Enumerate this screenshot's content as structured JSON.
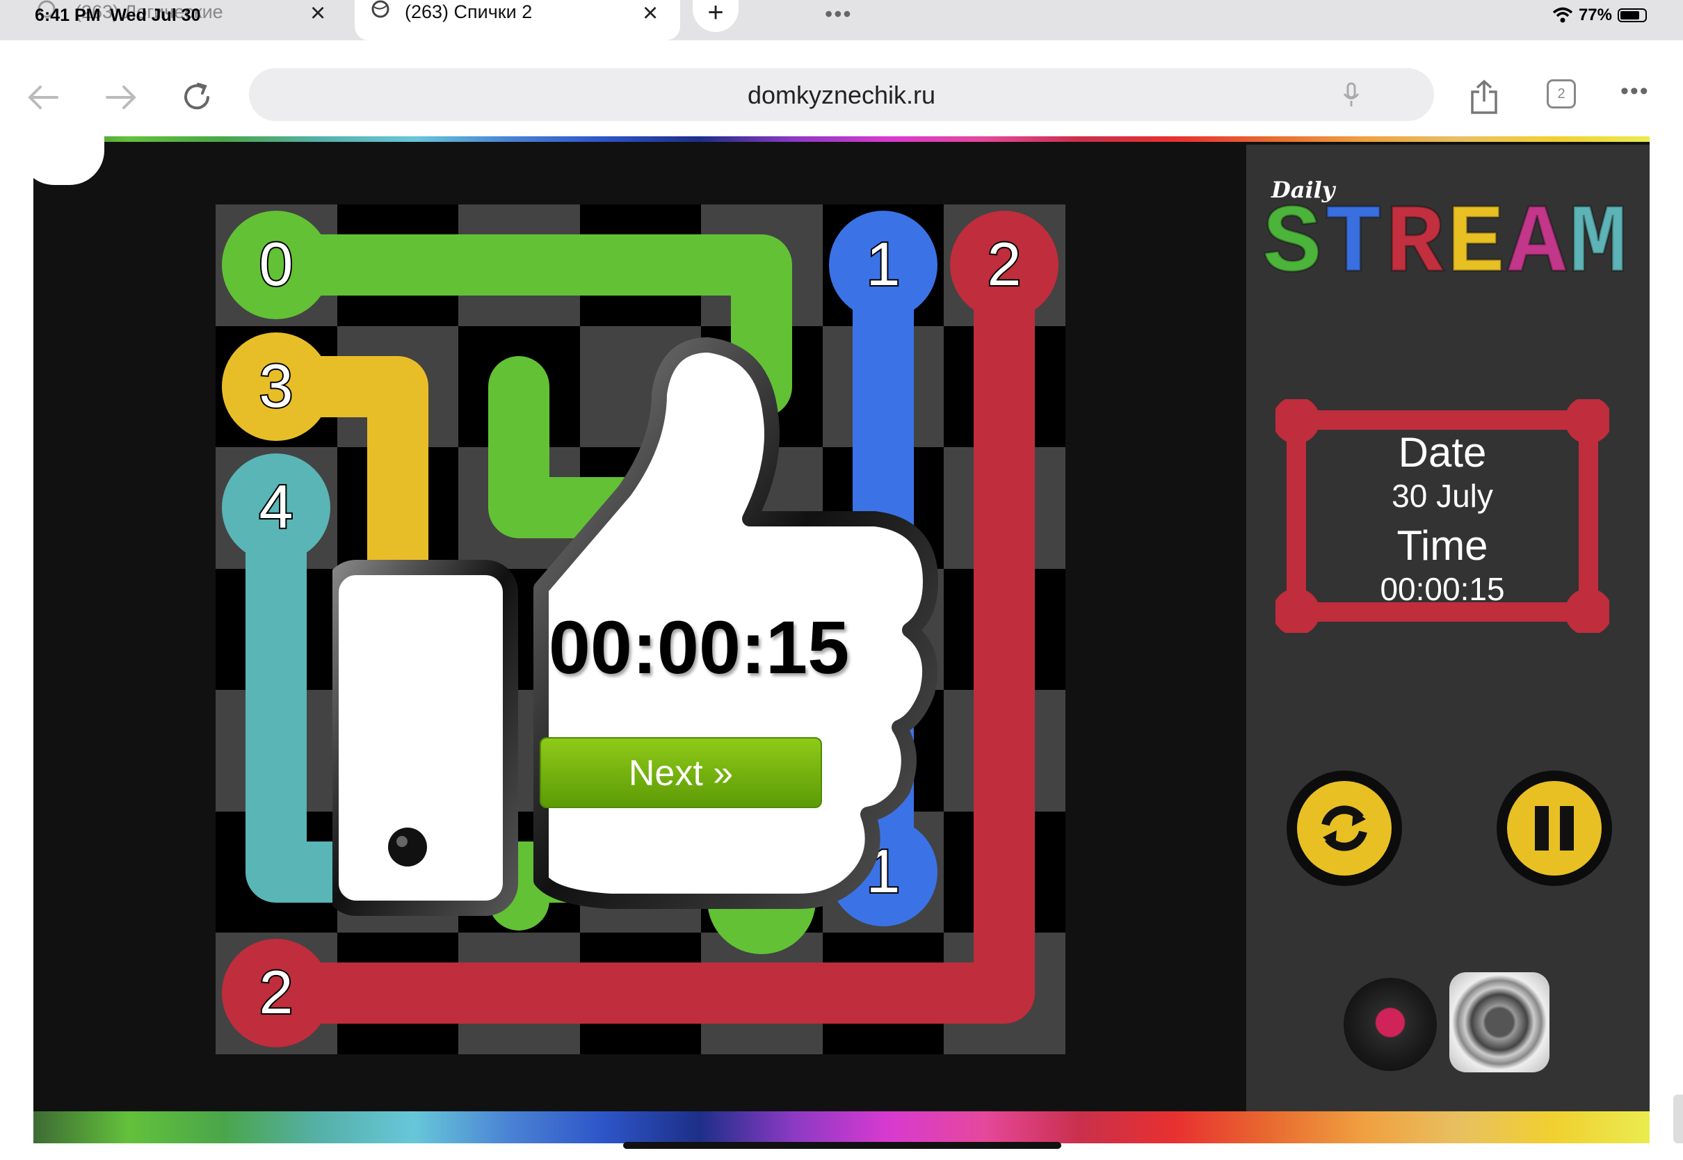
{
  "status": {
    "time": "6:41 PM",
    "date": "Wed Jul 30",
    "battery": "77%",
    "battery_level": 0.77
  },
  "tabs": [
    {
      "title": "(263) Логические"
    },
    {
      "title": "(263) Спички 2"
    }
  ],
  "toolbar": {
    "url": "domkyznechik.ru",
    "tab_count": "2"
  },
  "game": {
    "logo_top": "Daily",
    "logo_letters": [
      {
        "ch": "S",
        "color": "#4cb43a"
      },
      {
        "ch": "T",
        "color": "#3a6fe0"
      },
      {
        "ch": "R",
        "color": "#c2303f"
      },
      {
        "ch": "E",
        "color": "#e8c023"
      },
      {
        "ch": "A",
        "color": "#c2378a"
      },
      {
        "ch": "M",
        "color": "#5db3b5"
      }
    ],
    "date_label": "Date",
    "date_value": "30 July",
    "time_label": "Time",
    "time_value": "00:00:15",
    "overlay_timer": "00:00:15",
    "next_label": "Next »",
    "colors": {
      "green": "#63c135",
      "blue": "#3b73e6",
      "red": "#c02d3c",
      "yellow": "#e8be28",
      "teal": "#5ab5b6"
    },
    "endpoints": [
      {
        "label": "0",
        "color": "green"
      },
      {
        "label": "1",
        "color": "blue"
      },
      {
        "label": "2",
        "color": "red"
      },
      {
        "label": "3",
        "color": "yellow"
      },
      {
        "label": "4",
        "color": "teal"
      },
      {
        "label": "1",
        "color": "blue"
      },
      {
        "label": "2",
        "color": "red"
      }
    ],
    "icons": [
      "refresh-icon",
      "pause-icon",
      "record-icon",
      "speaker-icon",
      "thumbs-up-icon"
    ]
  }
}
